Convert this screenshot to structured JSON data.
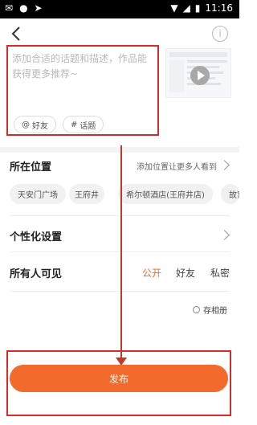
{
  "status_bar": {
    "time": "11:16",
    "left_icons": [
      "chat-icon",
      "wechat-icon",
      "send-icon"
    ],
    "right_icons": [
      "wifi-icon",
      "signal-icon",
      "battery-icon"
    ]
  },
  "header": {
    "back_icon": "chevron-left-icon",
    "info_icon": "info-icon",
    "info_glyph": "i"
  },
  "description": {
    "placeholder": "添加合适的话题和描述，作品能获得更多推荐~",
    "mention_label": "好友",
    "mention_glyph": "@",
    "topic_label": "话题",
    "topic_glyph": "#"
  },
  "location": {
    "title": "所在位置",
    "hint": "添加位置让更多人看到",
    "chips": [
      "天安门广场",
      "王府井",
      "希尔顿酒店(王府井店)",
      "故宫"
    ]
  },
  "personalization": {
    "title": "个性化设置"
  },
  "visibility": {
    "title": "所有人可见",
    "options": [
      "公开",
      "好友",
      "私密"
    ],
    "selected": "公开"
  },
  "save_to_album": {
    "label": "存相册"
  },
  "publish": {
    "label": "发布"
  },
  "colors": {
    "accent": "#f26a2c",
    "annotation": "#d72a2a"
  }
}
